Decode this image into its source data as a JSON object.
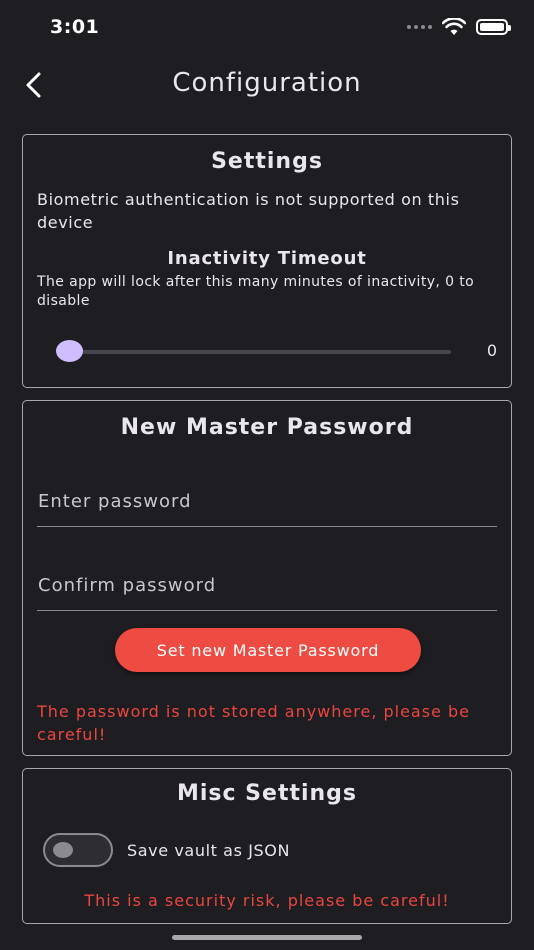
{
  "status_bar": {
    "time": "3:01",
    "icons": [
      "signal-icon",
      "wifi-icon",
      "battery-icon"
    ]
  },
  "header": {
    "title": "Configuration",
    "back_icon": "chevron-left-icon"
  },
  "settings": {
    "title": "Settings",
    "biometric_message": "Biometric authentication is not supported on this device",
    "timeout_title": "Inactivity Timeout",
    "timeout_description": "The app will lock after this many minutes of inactivity, 0 to disable",
    "timeout_value": "0"
  },
  "new_password": {
    "title": "New Master Password",
    "password_placeholder": "Enter password",
    "confirm_placeholder": "Confirm password",
    "submit_label": "Set new Master Password",
    "warning": "The password is not stored anywhere, please be careful!"
  },
  "misc": {
    "title": "Misc Settings",
    "toggle_label": "Save vault as JSON",
    "toggle_on": false,
    "warning": "This is a security risk, please be careful!"
  },
  "colors": {
    "background": "#1e1d21",
    "accent_button": "#ee4b43",
    "warning_text": "#e9463f",
    "slider_thumb": "#cfbdfd"
  }
}
